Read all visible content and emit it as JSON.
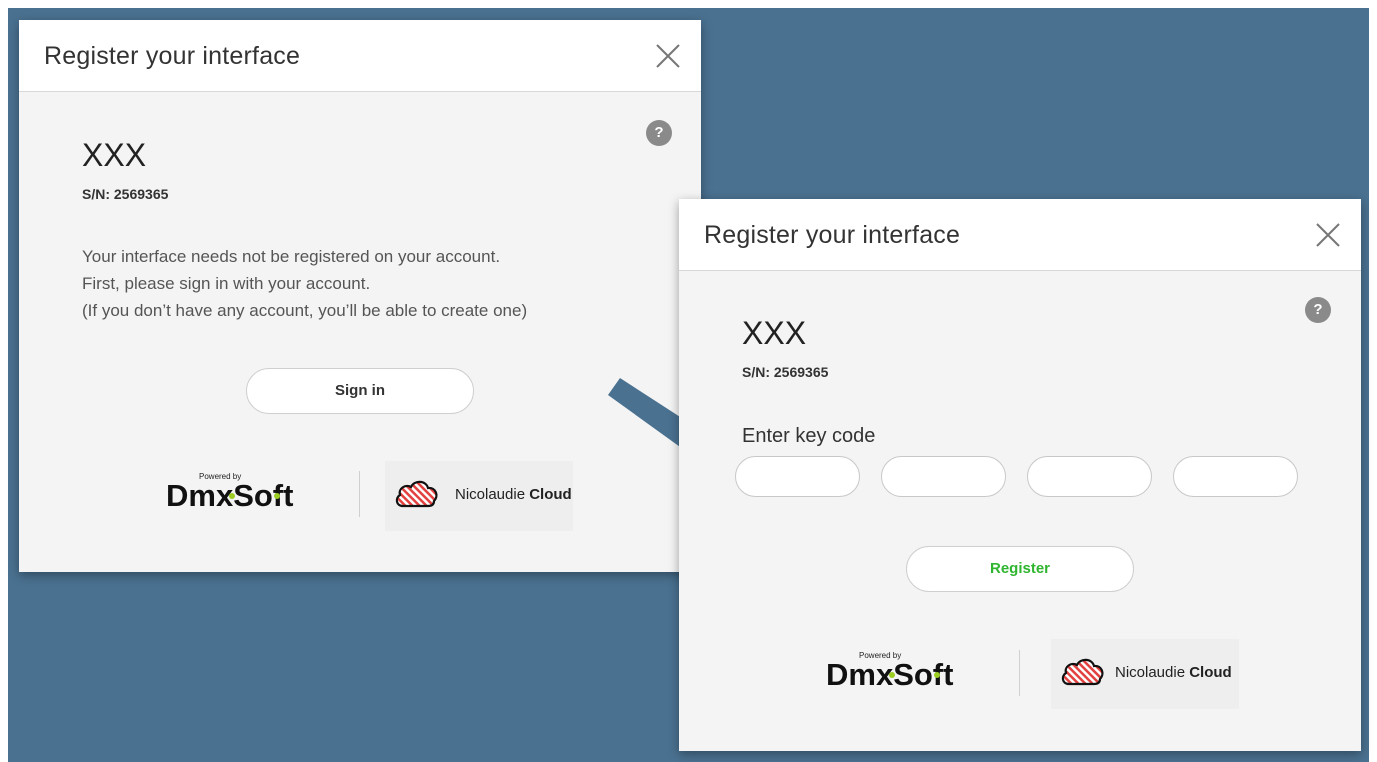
{
  "dialog_signin": {
    "title": "Register your interface",
    "help": "?",
    "device_name": "XXX",
    "serial": "S/N: 2569365",
    "message_lines": [
      "Your interface needs not be registered on your account.",
      "First, please sign in with your account.",
      "(If you don’t have any account, you’ll be able to create one)"
    ],
    "signin_label": "Sign in",
    "powered_by": "Powered by",
    "dmxsoft": "DmxSoft",
    "cloud_name_prefix": "Nicolaudie ",
    "cloud_name_bold": "Cloud"
  },
  "dialog_register": {
    "title": "Register your interface",
    "help": "?",
    "device_name": "XXX",
    "serial": "S/N: 2569365",
    "keycode_label": "Enter key code",
    "key_inputs": [
      "",
      "",
      "",
      ""
    ],
    "register_label": "Register",
    "powered_by": "Powered by",
    "dmxsoft": "DmxSoft",
    "cloud_name_prefix": "Nicolaudie ",
    "cloud_name_bold": "Cloud"
  },
  "colors": {
    "background": "#4a7190",
    "arrow": "#4a7190",
    "register_text": "#2fb52f",
    "cloud_logo": "#e2413f"
  }
}
